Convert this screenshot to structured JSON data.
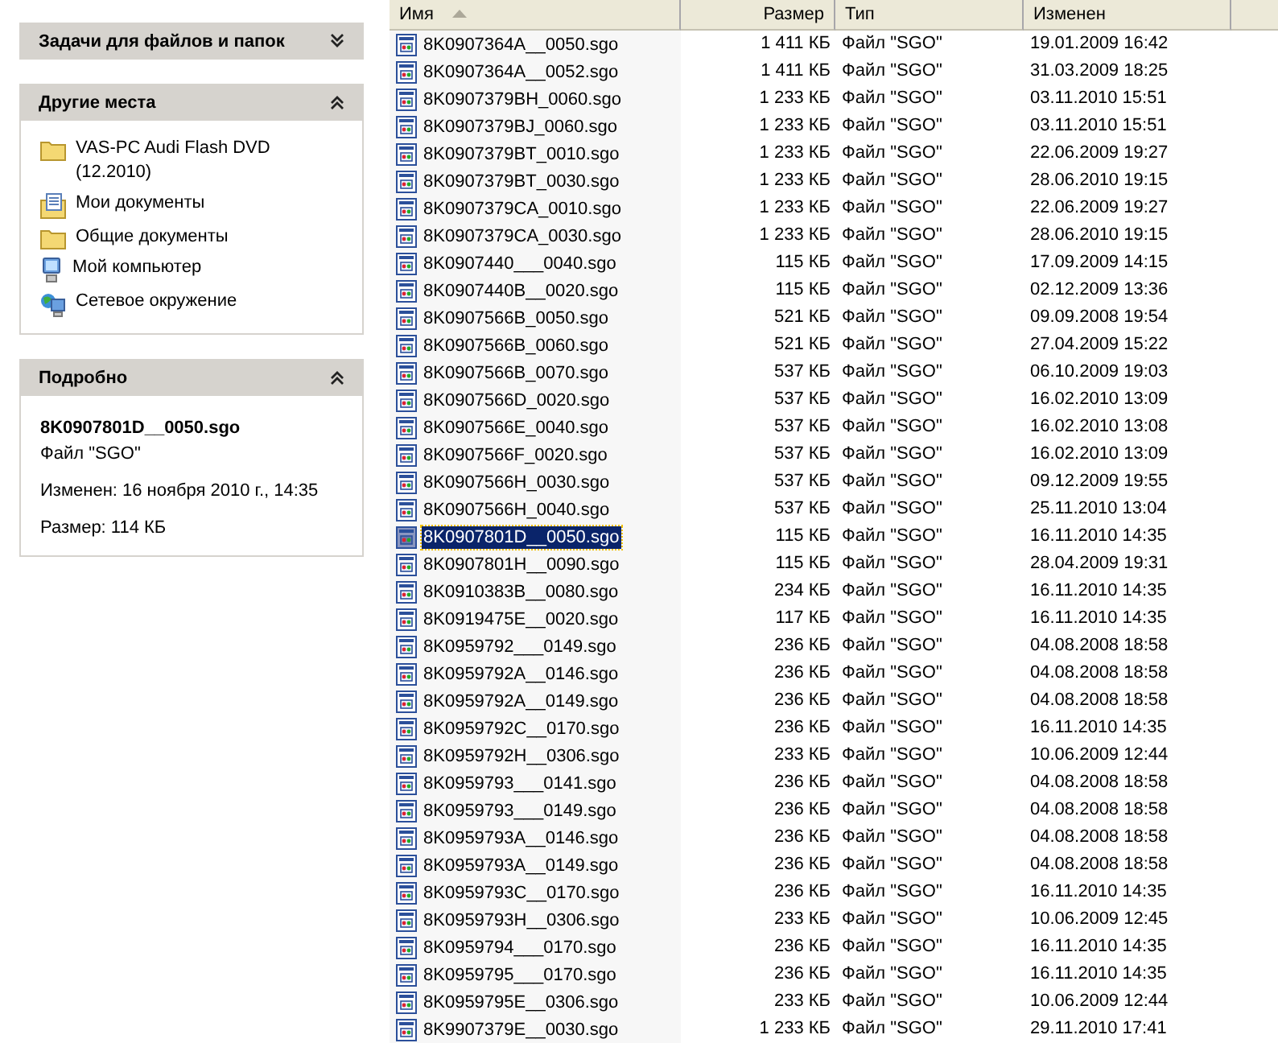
{
  "sidebar": {
    "panels": [
      {
        "kind": "tasks",
        "title": "Задачи для файлов и папок",
        "expanded": false
      },
      {
        "kind": "places",
        "title": "Другие места",
        "expanded": true,
        "items": [
          {
            "kind": "folder",
            "label": "VAS-PC Audi Flash DVD (12.2010)"
          },
          {
            "kind": "documents",
            "label": "Мои документы"
          },
          {
            "kind": "folder",
            "label": "Общие документы"
          },
          {
            "kind": "computer",
            "label": "Мой компьютер"
          },
          {
            "kind": "network",
            "label": "Сетевое окружение"
          }
        ]
      },
      {
        "kind": "details",
        "title": "Подробно",
        "expanded": true,
        "name": "8K0907801D__0050.sgo",
        "type": "Файл \"SGO\"",
        "modified": "Изменен: 16 ноября 2010 г., 14:35",
        "size": "Размер: 114 КБ"
      }
    ]
  },
  "table": {
    "columns": [
      {
        "label": "Имя",
        "sorted": true
      },
      {
        "label": "Размер",
        "sorted": false
      },
      {
        "label": "Тип",
        "sorted": false
      },
      {
        "label": "Изменен",
        "sorted": false
      }
    ],
    "rows": [
      {
        "name": "8K0907364A__0050.sgo",
        "size": "1 411 КБ",
        "type": "Файл \"SGO\"",
        "modified": "19.01.2009 16:42",
        "selected": false
      },
      {
        "name": "8K0907364A__0052.sgo",
        "size": "1 411 КБ",
        "type": "Файл \"SGO\"",
        "modified": "31.03.2009 18:25",
        "selected": false
      },
      {
        "name": "8K0907379BH_0060.sgo",
        "size": "1 233 КБ",
        "type": "Файл \"SGO\"",
        "modified": "03.11.2010 15:51",
        "selected": false
      },
      {
        "name": "8K0907379BJ_0060.sgo",
        "size": "1 233 КБ",
        "type": "Файл \"SGO\"",
        "modified": "03.11.2010 15:51",
        "selected": false
      },
      {
        "name": "8K0907379BT_0010.sgo",
        "size": "1 233 КБ",
        "type": "Файл \"SGO\"",
        "modified": "22.06.2009 19:27",
        "selected": false
      },
      {
        "name": "8K0907379BT_0030.sgo",
        "size": "1 233 КБ",
        "type": "Файл \"SGO\"",
        "modified": "28.06.2010 19:15",
        "selected": false
      },
      {
        "name": "8K0907379CA_0010.sgo",
        "size": "1 233 КБ",
        "type": "Файл \"SGO\"",
        "modified": "22.06.2009 19:27",
        "selected": false
      },
      {
        "name": "8K0907379CA_0030.sgo",
        "size": "1 233 КБ",
        "type": "Файл \"SGO\"",
        "modified": "28.06.2010 19:15",
        "selected": false
      },
      {
        "name": "8K0907440___0040.sgo",
        "size": "115 КБ",
        "type": "Файл \"SGO\"",
        "modified": "17.09.2009 14:15",
        "selected": false
      },
      {
        "name": "8K0907440B__0020.sgo",
        "size": "115 КБ",
        "type": "Файл \"SGO\"",
        "modified": "02.12.2009 13:36",
        "selected": false
      },
      {
        "name": "8K0907566B_0050.sgo",
        "size": "521 КБ",
        "type": "Файл \"SGO\"",
        "modified": "09.09.2008 19:54",
        "selected": false
      },
      {
        "name": "8K0907566B_0060.sgo",
        "size": "521 КБ",
        "type": "Файл \"SGO\"",
        "modified": "27.04.2009 15:22",
        "selected": false
      },
      {
        "name": "8K0907566B_0070.sgo",
        "size": "537 КБ",
        "type": "Файл \"SGO\"",
        "modified": "06.10.2009 19:03",
        "selected": false
      },
      {
        "name": "8K0907566D_0020.sgo",
        "size": "537 КБ",
        "type": "Файл \"SGO\"",
        "modified": "16.02.2010 13:09",
        "selected": false
      },
      {
        "name": "8K0907566E_0040.sgo",
        "size": "537 КБ",
        "type": "Файл \"SGO\"",
        "modified": "16.02.2010 13:08",
        "selected": false
      },
      {
        "name": "8K0907566F_0020.sgo",
        "size": "537 КБ",
        "type": "Файл \"SGO\"",
        "modified": "16.02.2010 13:09",
        "selected": false
      },
      {
        "name": "8K0907566H_0030.sgo",
        "size": "537 КБ",
        "type": "Файл \"SGO\"",
        "modified": "09.12.2009 19:55",
        "selected": false
      },
      {
        "name": "8K0907566H_0040.sgo",
        "size": "537 КБ",
        "type": "Файл \"SGO\"",
        "modified": "25.11.2010 13:04",
        "selected": false
      },
      {
        "name": "8K0907801D__0050.sgo",
        "size": "115 КБ",
        "type": "Файл \"SGO\"",
        "modified": "16.11.2010 14:35",
        "selected": true
      },
      {
        "name": "8K0907801H__0090.sgo",
        "size": "115 КБ",
        "type": "Файл \"SGO\"",
        "modified": "28.04.2009 19:31",
        "selected": false
      },
      {
        "name": "8K0910383B__0080.sgo",
        "size": "234 КБ",
        "type": "Файл \"SGO\"",
        "modified": "16.11.2010 14:35",
        "selected": false
      },
      {
        "name": "8K0919475E__0020.sgo",
        "size": "117 КБ",
        "type": "Файл \"SGO\"",
        "modified": "16.11.2010 14:35",
        "selected": false
      },
      {
        "name": "8K0959792___0149.sgo",
        "size": "236 КБ",
        "type": "Файл \"SGO\"",
        "modified": "04.08.2008 18:58",
        "selected": false
      },
      {
        "name": "8K0959792A__0146.sgo",
        "size": "236 КБ",
        "type": "Файл \"SGO\"",
        "modified": "04.08.2008 18:58",
        "selected": false
      },
      {
        "name": "8K0959792A__0149.sgo",
        "size": "236 КБ",
        "type": "Файл \"SGO\"",
        "modified": "04.08.2008 18:58",
        "selected": false
      },
      {
        "name": "8K0959792C__0170.sgo",
        "size": "236 КБ",
        "type": "Файл \"SGO\"",
        "modified": "16.11.2010 14:35",
        "selected": false
      },
      {
        "name": "8K0959792H__0306.sgo",
        "size": "233 КБ",
        "type": "Файл \"SGO\"",
        "modified": "10.06.2009 12:44",
        "selected": false
      },
      {
        "name": "8K0959793___0141.sgo",
        "size": "236 КБ",
        "type": "Файл \"SGO\"",
        "modified": "04.08.2008 18:58",
        "selected": false
      },
      {
        "name": "8K0959793___0149.sgo",
        "size": "236 КБ",
        "type": "Файл \"SGO\"",
        "modified": "04.08.2008 18:58",
        "selected": false
      },
      {
        "name": "8K0959793A__0146.sgo",
        "size": "236 КБ",
        "type": "Файл \"SGO\"",
        "modified": "04.08.2008 18:58",
        "selected": false
      },
      {
        "name": "8K0959793A__0149.sgo",
        "size": "236 КБ",
        "type": "Файл \"SGO\"",
        "modified": "04.08.2008 18:58",
        "selected": false
      },
      {
        "name": "8K0959793C__0170.sgo",
        "size": "236 КБ",
        "type": "Файл \"SGO\"",
        "modified": "16.11.2010 14:35",
        "selected": false
      },
      {
        "name": "8K0959793H__0306.sgo",
        "size": "233 КБ",
        "type": "Файл \"SGO\"",
        "modified": "10.06.2009 12:45",
        "selected": false
      },
      {
        "name": "8K0959794___0170.sgo",
        "size": "236 КБ",
        "type": "Файл \"SGO\"",
        "modified": "16.11.2010 14:35",
        "selected": false
      },
      {
        "name": "8K0959795___0170.sgo",
        "size": "236 КБ",
        "type": "Файл \"SGO\"",
        "modified": "16.11.2010 14:35",
        "selected": false
      },
      {
        "name": "8K0959795E__0306.sgo",
        "size": "233 КБ",
        "type": "Файл \"SGO\"",
        "modified": "10.06.2009 12:44",
        "selected": false
      },
      {
        "name": "8K9907379E__0030.sgo",
        "size": "1 233 КБ",
        "type": "Файл \"SGO\"",
        "modified": "29.11.2010 17:41",
        "selected": false
      }
    ]
  }
}
